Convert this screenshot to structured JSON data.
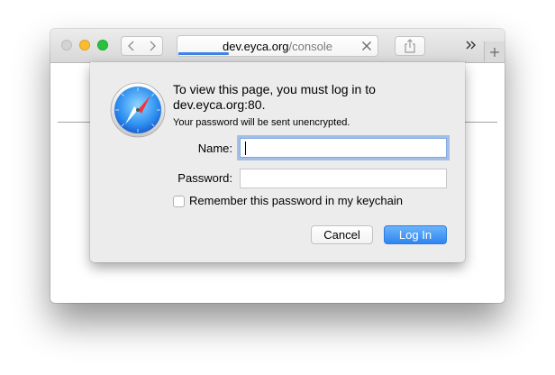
{
  "browser": {
    "address_domain": "dev.eyca.org",
    "address_path": "/console",
    "load_progress_percent": 25,
    "icons": {
      "back": "chevron-left-icon",
      "forward": "chevron-right-icon",
      "stop": "close-icon",
      "share": "share-icon",
      "overflow": "double-chevron-right-icon",
      "new_tab": "plus-icon"
    }
  },
  "auth_dialog": {
    "icon": "safari-compass-icon",
    "message": "To view this page, you must log in to dev.eyca.org:80.",
    "warning": "Your password will be sent unencrypted.",
    "name_label": "Name:",
    "name_value": "",
    "password_label": "Password:",
    "password_value": "",
    "remember_label": "Remember this password in my keychain",
    "remember_checked": false,
    "cancel_label": "Cancel",
    "login_label": "Log In"
  },
  "colors": {
    "accent": "#2e86f0",
    "focus_ring": "#679be6",
    "progress": "#3d84e6"
  }
}
